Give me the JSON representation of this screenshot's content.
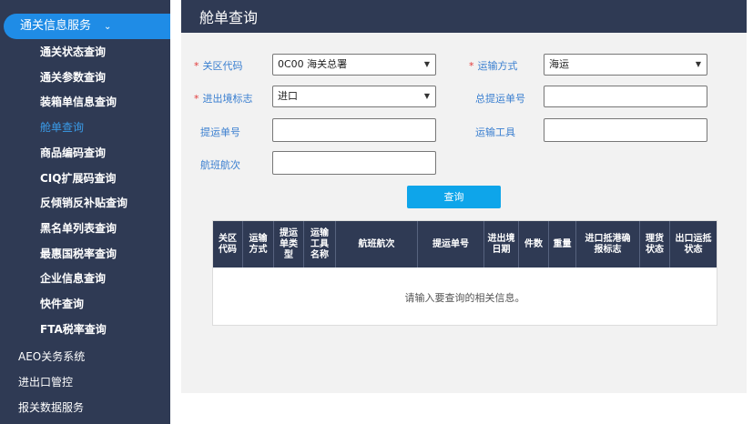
{
  "sidebar": {
    "group_title": "通关信息服务",
    "group_chevron": "⌄",
    "items": [
      {
        "label": "通关状态查询"
      },
      {
        "label": "通关参数查询"
      },
      {
        "label": "装箱单信息查询"
      },
      {
        "label": "舱单查询"
      },
      {
        "label": "商品编码查询"
      },
      {
        "label": "CIQ扩展码查询"
      },
      {
        "label": "反倾销反补贴查询"
      },
      {
        "label": "黑名单列表查询"
      },
      {
        "label": "最惠国税率查询"
      },
      {
        "label": "企业信息查询"
      },
      {
        "label": "快件查询"
      },
      {
        "label": "FTA税率查询"
      }
    ],
    "top_items": [
      {
        "label": "AEO关务系统"
      },
      {
        "label": "进出口管控"
      },
      {
        "label": "报关数据服务"
      }
    ]
  },
  "header": {
    "title": "舱单查询"
  },
  "form": {
    "customs_code": {
      "label": "关区代码",
      "value": "0C00 海关总署"
    },
    "transport_mode": {
      "label": "运输方式",
      "value": "海运"
    },
    "ie_flag": {
      "label": "进出境标志",
      "value": "进口"
    },
    "master_bill": {
      "label": "总提运单号",
      "value": ""
    },
    "bill_no": {
      "label": "提运单号",
      "value": ""
    },
    "transport_tool": {
      "label": "运输工具",
      "value": ""
    },
    "voyage": {
      "label": "航班航次",
      "value": ""
    },
    "query_label": "查询"
  },
  "table": {
    "columns": [
      "关区\n代码",
      "运输\n方式",
      "提运\n单类\n型",
      "运输\n工具\n名称",
      "航班航次",
      "提运单号",
      "进出境\n日期",
      "件数",
      "重量",
      "进口抵港确\n报标志",
      "理货\n状态",
      "出口运抵\n状态"
    ],
    "empty_message": "请输入要查询的相关信息。"
  },
  "colors": {
    "sidebar_bg": "#2f3a54",
    "active_blue": "#1f8ce6",
    "label_blue": "#3a7fd0",
    "required_red": "#e23a3a",
    "button_blue": "#0ea5ea"
  }
}
